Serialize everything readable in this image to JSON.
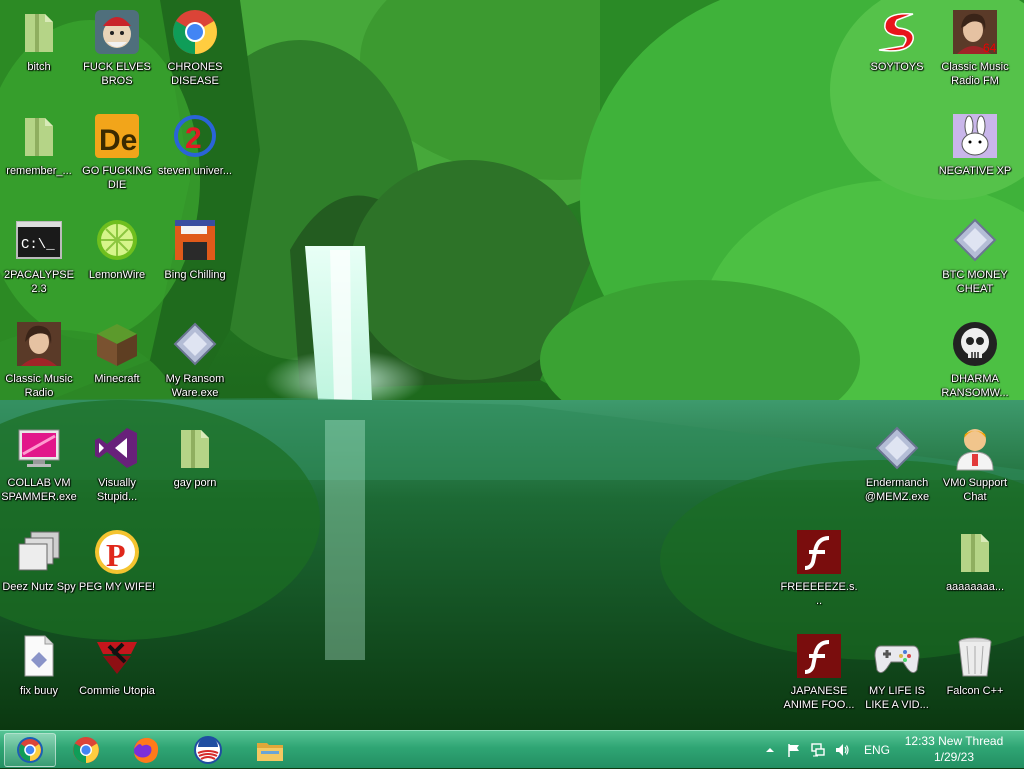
{
  "desktop": {
    "icons": [
      {
        "label": "bitch",
        "icon": "folder-icon"
      },
      {
        "label": "FUCK ELVES BROS",
        "icon": "elf-app-icon"
      },
      {
        "label": "CHRONES DISEASE",
        "icon": "chrome-icon"
      },
      {
        "label": "SOYTOYS",
        "icon": "sonic-s-logo-icon"
      },
      {
        "label": "Classic Music Radio FM",
        "icon": "portrait-icon"
      },
      {
        "label": "remember_...",
        "icon": "folder-icon"
      },
      {
        "label": "GO FUCKING DIE",
        "icon": "de-app-icon"
      },
      {
        "label": "steven univer...",
        "icon": "two-badge-icon"
      },
      {
        "label": "NEGATIVE XP",
        "icon": "bunny-icon"
      },
      {
        "label": "2PACALYPSE 2.3",
        "icon": "terminal-icon"
      },
      {
        "label": "LemonWire",
        "icon": "lime-icon"
      },
      {
        "label": "Bing Chilling",
        "icon": "floppy-disk-icon"
      },
      {
        "label": "BTC MONEY CHEAT",
        "icon": "generic-app-icon"
      },
      {
        "label": "Classic Music Radio",
        "icon": "portrait-icon"
      },
      {
        "label": "Minecraft",
        "icon": "grass-block-icon"
      },
      {
        "label": "My Ransom Ware.exe",
        "icon": "generic-app-icon"
      },
      {
        "label": "DHARMA RANSOMW...",
        "icon": "skull-icon"
      },
      {
        "label": "COLLAB VM SPAMMER.exe",
        "icon": "pink-monitor-icon"
      },
      {
        "label": "Visually Stupid...",
        "icon": "visual-studio-icon"
      },
      {
        "label": "gay porn",
        "icon": "folder-icon"
      },
      {
        "label": "Endermanch @MEMZ.exe",
        "icon": "generic-app-icon"
      },
      {
        "label": "VM0 Support Chat",
        "icon": "support-agent-icon"
      },
      {
        "label": "Deez Nutz Spy",
        "icon": "stacked-windows-icon"
      },
      {
        "label": "PEG MY WIFE!",
        "icon": "p-logo-icon"
      },
      {
        "label": "FREEEEEZE.s...",
        "icon": "flash-icon"
      },
      {
        "label": "aaaaaaaa...",
        "icon": "folder-icon"
      },
      {
        "label": "fix buuy",
        "icon": "script-file-icon"
      },
      {
        "label": "Commie Utopia",
        "icon": "hammer-emblem-icon"
      },
      {
        "label": "JAPANESE ANIME FOO...",
        "icon": "flash-icon"
      },
      {
        "label": "MY LIFE IS LIKE A VID...",
        "icon": "gamepad-icon"
      },
      {
        "label": "Falcon C++",
        "icon": "recycle-bin-icon"
      }
    ]
  },
  "taskbar": {
    "pinned": [
      {
        "name": "start-button",
        "icon": "start-orb-icon"
      },
      {
        "name": "chrome",
        "icon": "chrome-icon"
      },
      {
        "name": "firefox",
        "icon": "firefox-icon"
      },
      {
        "name": "obama",
        "icon": "obama-logo-icon"
      },
      {
        "name": "file-explorer",
        "icon": "file-explorer-icon"
      }
    ],
    "tray": {
      "language": "ENG",
      "time": "12:33 New Thread",
      "date": "1/29/23"
    }
  },
  "colors": {
    "taskbar": "#2fa574",
    "label_text": "#ffffff"
  }
}
